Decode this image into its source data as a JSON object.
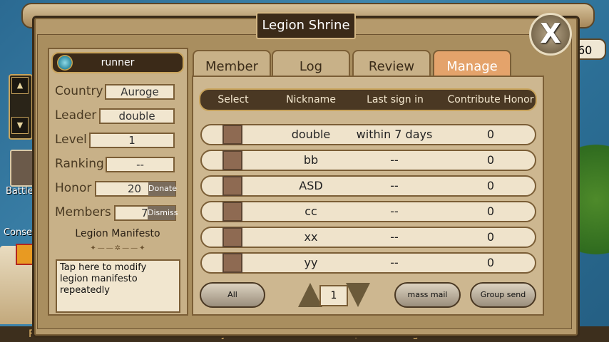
{
  "dialog": {
    "title": "Legion Shrine",
    "close_label": "X"
  },
  "background": {
    "battle_label": "Battle",
    "conse_label": "Conse",
    "corner_value": "60"
  },
  "legion_info": {
    "name": "runner",
    "country_label": "Country",
    "country": "Auroge",
    "leader_label": "Leader",
    "leader": "double",
    "level_label": "Level",
    "level": "1",
    "ranking_label": "Ranking",
    "ranking": "--",
    "honor_label": "Honor",
    "honor": "20",
    "donate_label": "Donate",
    "members_label": "Members",
    "members": "7",
    "dismiss_label": "Dismiss",
    "manifesto_title": "Legion Manifesto",
    "manifesto_ornament": "✦——✲——✦",
    "manifesto_text": "Tap here to modify legion manifesto repeatedly"
  },
  "tabs": [
    {
      "label": "Member"
    },
    {
      "label": "Log"
    },
    {
      "label": "Review"
    },
    {
      "label": "Manage"
    }
  ],
  "table": {
    "headers": [
      "Select",
      "Nickname",
      "Last sign in",
      "Contribute Honor"
    ],
    "rows": [
      {
        "nickname": "double",
        "last_sign_in": "within 7 days",
        "honor": "0"
      },
      {
        "nickname": "bb",
        "last_sign_in": "--",
        "honor": "0"
      },
      {
        "nickname": "ASD",
        "last_sign_in": "--",
        "honor": "0"
      },
      {
        "nickname": "cc",
        "last_sign_in": "--",
        "honor": "0"
      },
      {
        "nickname": "xx",
        "last_sign_in": "--",
        "honor": "0"
      },
      {
        "nickname": "yy",
        "last_sign_in": "--",
        "honor": "0"
      }
    ]
  },
  "actions": {
    "all_label": "All",
    "page": "1",
    "mass_mail_label": "mass mail",
    "group_send_label": "Group send"
  },
  "bottom_nav": [
    "Facebook",
    "Friends",
    "Character",
    "Military",
    "Item",
    "Enhance",
    "Quest",
    "Legion",
    "Mall",
    "Interaction"
  ]
}
